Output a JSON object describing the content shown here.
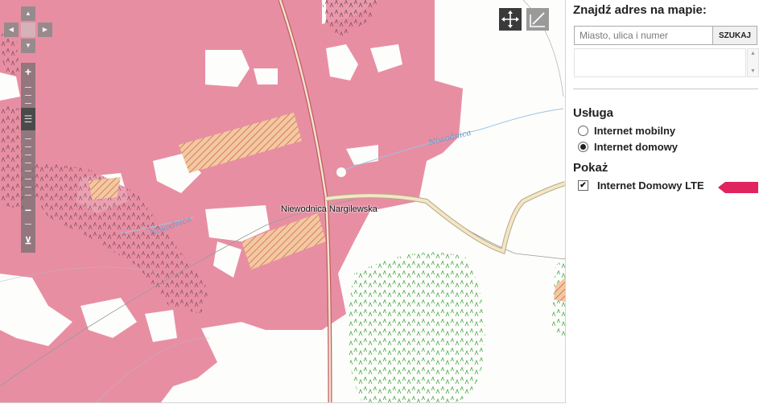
{
  "map": {
    "place_label": "Niewodnica Nargilewska",
    "river_labels": [
      "Niwodnica",
      "Niwodnica"
    ],
    "coverage_color": "#e88ea3",
    "road_color": "#f3e6c8"
  },
  "controls": {
    "pan_up": "▲",
    "pan_left": "◀",
    "pan_right": "▶",
    "pan_down": "▼",
    "zoom_in": "+",
    "zoom_out": "−",
    "zoom_handle": "☰",
    "zoom_bottom": "⊻"
  },
  "tools": {
    "move": "move-icon",
    "draw": "draw-icon"
  },
  "search": {
    "title": "Znajdź adres na mapie:",
    "placeholder": "Miasto, ulica i numer",
    "button": "SZUKAJ"
  },
  "service": {
    "title": "Usługa",
    "options": [
      {
        "label": "Internet mobilny",
        "selected": false
      },
      {
        "label": "Internet domowy",
        "selected": true
      }
    ]
  },
  "show": {
    "title": "Pokaż",
    "layers": [
      {
        "label": "Internet Domowy LTE",
        "checked": true,
        "color": "#e0245e"
      }
    ]
  }
}
